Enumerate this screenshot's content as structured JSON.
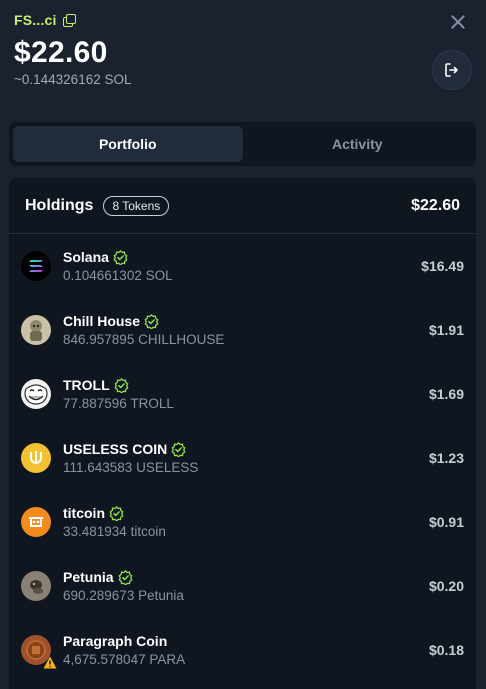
{
  "header": {
    "wallet_name": "FS...ci",
    "balance": "$22.60",
    "sol_balance": "~0.144326162 SOL"
  },
  "tabs": [
    {
      "label": "Portfolio",
      "active": true
    },
    {
      "label": "Activity",
      "active": false
    }
  ],
  "holdings": {
    "title": "Holdings",
    "badge": "8 Tokens",
    "total": "$22.60",
    "tokens": [
      {
        "name": "Solana",
        "amount": "0.104661302 SOL",
        "value": "$16.49",
        "verified": true,
        "icon": "solana-icon",
        "color": "#000000"
      },
      {
        "name": "Chill House",
        "amount": "846.957895 CHILLHOUSE",
        "value": "$1.91",
        "verified": true,
        "icon": "chill-house-icon",
        "color": "#c9c2a6"
      },
      {
        "name": "TROLL",
        "amount": "77.887596 TROLL",
        "value": "$1.69",
        "verified": true,
        "icon": "troll-face-icon",
        "color": "#f2f2f2"
      },
      {
        "name": "USELESS COIN",
        "amount": "111.643583 USELESS",
        "value": "$1.23",
        "verified": true,
        "icon": "useless-coin-icon",
        "color": "#f2c230"
      },
      {
        "name": "titcoin",
        "amount": "33.481934 titcoin",
        "value": "$0.91",
        "verified": true,
        "icon": "titcoin-icon",
        "color": "#f28c1e"
      },
      {
        "name": "Petunia",
        "amount": "690.289673 Petunia",
        "value": "$0.20",
        "verified": true,
        "icon": "petunia-icon",
        "color": "#8a8175"
      },
      {
        "name": "Paragraph Coin",
        "amount": "4,675.578047 PARA",
        "value": "$0.18",
        "verified": false,
        "icon": "paragraph-coin-icon",
        "color": "#a0522d",
        "warning": true
      }
    ]
  },
  "colors": {
    "accent": "#c6f26b",
    "background": "#1a2230",
    "panel": "#0f1620",
    "verified": "#8fe04a",
    "warning": "#f5b21b"
  }
}
